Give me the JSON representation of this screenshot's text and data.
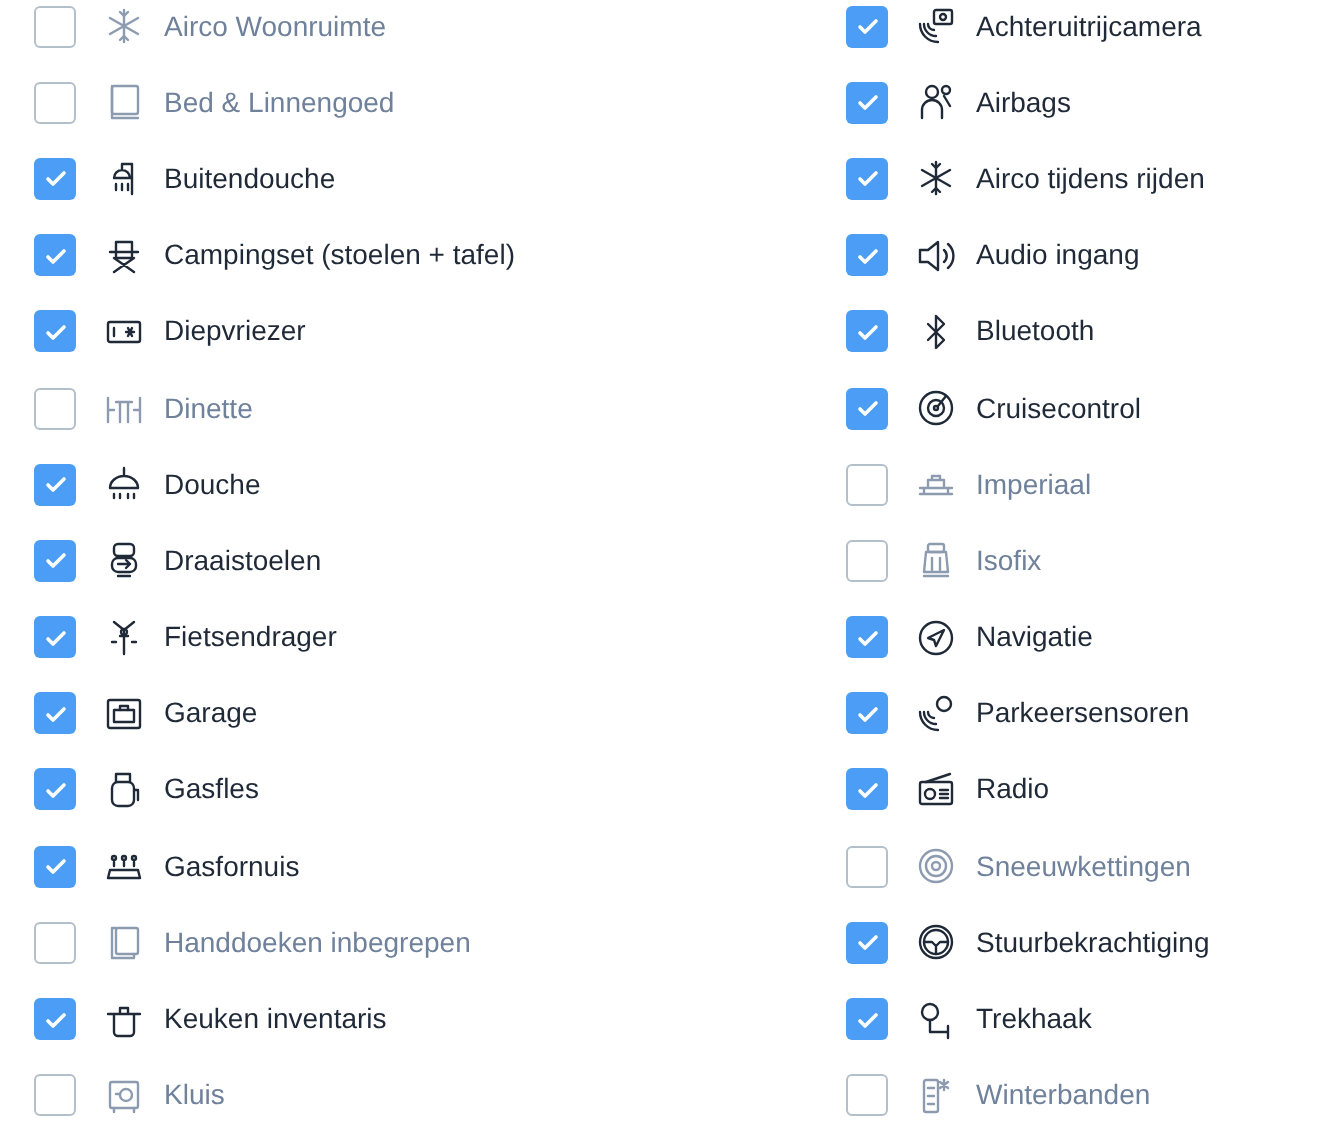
{
  "columns": [
    {
      "items": [
        {
          "label": "Airco Woonruimte",
          "checked": false
        },
        {
          "label": "Bed & Linnengoed",
          "checked": false
        },
        {
          "label": "Buitendouche",
          "checked": true
        },
        {
          "label": "Campingset (stoelen + tafel)",
          "checked": true
        },
        {
          "label": "Diepvriezer",
          "checked": true
        },
        {
          "label": "Dinette",
          "checked": false
        },
        {
          "label": "Douche",
          "checked": true
        },
        {
          "label": "Draaistoelen",
          "checked": true
        },
        {
          "label": "Fietsendrager",
          "checked": true
        },
        {
          "label": "Garage",
          "checked": true
        },
        {
          "label": "Gasfles",
          "checked": true
        },
        {
          "label": "Gasfornuis",
          "checked": true
        },
        {
          "label": "Handdoeken inbegrepen",
          "checked": false
        },
        {
          "label": "Keuken inventaris",
          "checked": true
        },
        {
          "label": "Kluis",
          "checked": false
        }
      ]
    },
    {
      "items": [
        {
          "label": "Achteruitrijcamera",
          "checked": true
        },
        {
          "label": "Airbags",
          "checked": true
        },
        {
          "label": "Airco tijdens rijden",
          "checked": true
        },
        {
          "label": "Audio ingang",
          "checked": true
        },
        {
          "label": "Bluetooth",
          "checked": true
        },
        {
          "label": "Cruisecontrol",
          "checked": true
        },
        {
          "label": "Imperiaal",
          "checked": false
        },
        {
          "label": "Isofix",
          "checked": false
        },
        {
          "label": "Navigatie",
          "checked": true
        },
        {
          "label": "Parkeersensoren",
          "checked": true
        },
        {
          "label": "Radio",
          "checked": true
        },
        {
          "label": "Sneeuwkettingen",
          "checked": false
        },
        {
          "label": "Stuurbekrachtiging",
          "checked": true
        },
        {
          "label": "Trekhaak",
          "checked": true
        },
        {
          "label": "Winterbanden",
          "checked": false
        }
      ]
    }
  ]
}
